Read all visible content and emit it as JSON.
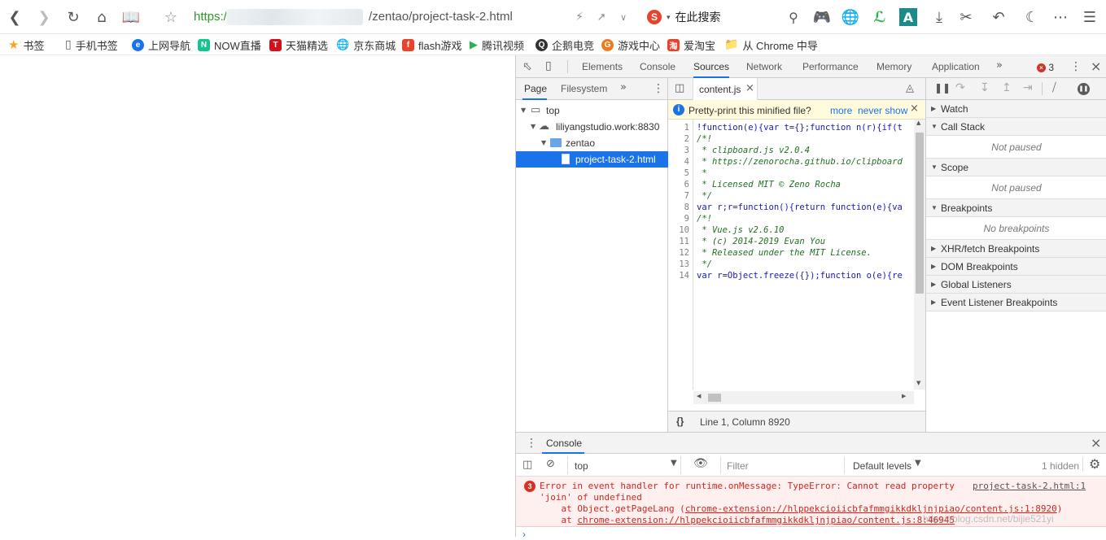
{
  "browser": {
    "url": {
      "scheme": "https://",
      "rest": "/zentao/project-task-2.html"
    },
    "search_label": "在此搜索",
    "sogou_letter": "S"
  },
  "bookmarks": [
    {
      "label": "书签",
      "icon": "star-icon",
      "color": "#f5a623"
    },
    {
      "label": "手机书签",
      "icon": "phone-icon",
      "color": "#888888"
    },
    {
      "label": "上网导航",
      "icon": "ie-icon",
      "color": "#1a73e8"
    },
    {
      "label": "NOW直播",
      "icon": "now-icon",
      "color": "#14c48e"
    },
    {
      "label": "天猫精选",
      "icon": "tmall-icon",
      "color": "#d4101b"
    },
    {
      "label": "京东商城",
      "icon": "globe-icon",
      "color": "#777777"
    },
    {
      "label": "flash游戏",
      "icon": "flash-icon",
      "color": "#e8442d"
    },
    {
      "label": "腾讯视频",
      "icon": "tencent-video-icon",
      "color": "#2bb24c"
    },
    {
      "label": "企鹅电竞",
      "icon": "penguin-icon",
      "color": "#333333"
    },
    {
      "label": "游戏中心",
      "icon": "gamepad-icon",
      "color": "#f07b1f"
    },
    {
      "label": "爱淘宝",
      "icon": "taobao-icon",
      "color": "#e8442d"
    },
    {
      "label": "从 Chrome 中导",
      "icon": "folder-icon",
      "color": "#f2c14e"
    }
  ],
  "devtools": {
    "tabs": [
      "Elements",
      "Console",
      "Sources",
      "Network",
      "Performance",
      "Memory",
      "Application"
    ],
    "active_tab": "Sources",
    "error_count": "3",
    "navigator": {
      "tabs": [
        "Page",
        "Filesystem"
      ],
      "tree": [
        "top",
        "liliyangstudio.work:8830",
        "zentao",
        "project-task-2.html"
      ]
    },
    "editor": {
      "file_tab": "content.js",
      "prettyprint_msg": "Pretty-print this minified file?",
      "more": "more",
      "never_show": "never show",
      "lines": [
        {
          "n": "1",
          "text": "!function(e){var t={};function n(r){if(t"
        },
        {
          "n": "2",
          "text": "/*!"
        },
        {
          "n": "3",
          "text": " * clipboard.js v2.0.4"
        },
        {
          "n": "4",
          "text": " * https://zenorocha.github.io/clipboard"
        },
        {
          "n": "5",
          "text": " *"
        },
        {
          "n": "6",
          "text": " * Licensed MIT © Zeno Rocha"
        },
        {
          "n": "7",
          "text": " */"
        },
        {
          "n": "8",
          "text": "var r;r=function(){return function(e){va"
        },
        {
          "n": "9",
          "text": "/*!"
        },
        {
          "n": "10",
          "text": " * Vue.js v2.6.10"
        },
        {
          "n": "11",
          "text": " * (c) 2014-2019 Evan You"
        },
        {
          "n": "12",
          "text": " * Released under the MIT License."
        },
        {
          "n": "13",
          "text": " */"
        },
        {
          "n": "14",
          "text": "var r=Object.freeze({});function o(e){re"
        }
      ],
      "status": "Line 1, Column 8920"
    },
    "sidebar": {
      "watch": "Watch",
      "call_stack": "Call Stack",
      "not_paused": "Not paused",
      "scope": "Scope",
      "breakpoints": "Breakpoints",
      "no_breakpoints": "No breakpoints",
      "xhr": "XHR/fetch Breakpoints",
      "dom": "DOM Breakpoints",
      "global": "Global Listeners",
      "event": "Event Listener Breakpoints"
    },
    "console": {
      "title": "Console",
      "context": "top",
      "filter_placeholder": "Filter",
      "levels": "Default levels",
      "hidden": "1 hidden",
      "error_count": "3",
      "error_line1": "Error in event handler for runtime.onMessage: TypeError: Cannot read property",
      "error_line2": "'join' of undefined",
      "error_line3_prefix": "    at Object.getPageLang (",
      "error_line3_link": "chrome-extension://hlppekcioiicbfafmmgikkdkljnjpiao/content.js:1:8920",
      "error_line3_suffix": ")",
      "error_line4_prefix": "    at ",
      "error_line4_link": "chrome-extension://hlppekcioiicbfafmmgikkdkljnjpiao/content.js:8:46945",
      "error_source": "project-task-2.html:1",
      "watermark": "https://blog.csdn.net/bijie521yi"
    }
  }
}
